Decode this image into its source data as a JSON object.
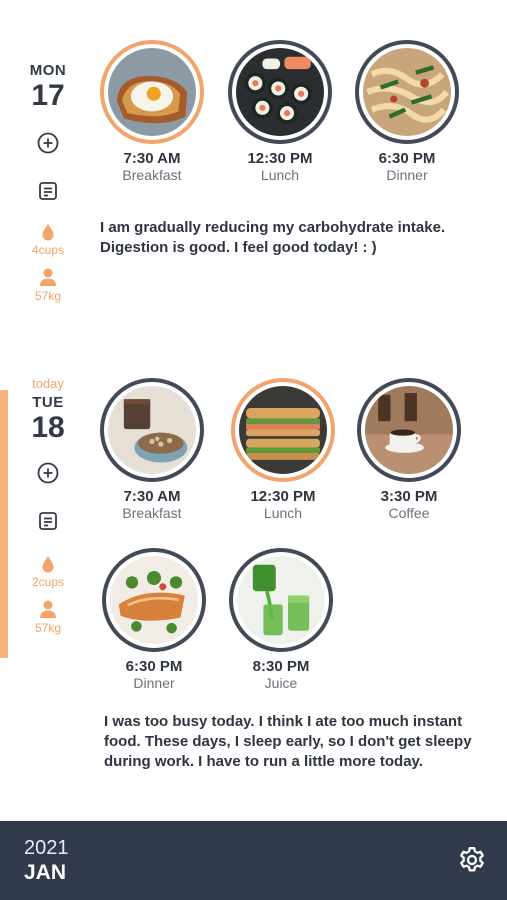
{
  "days": [
    {
      "today_label": "",
      "dow": "MON",
      "date": "17",
      "water": "4cups",
      "weight": "57kg",
      "meals": [
        {
          "time": "7:30 AM",
          "label": "Breakfast",
          "highlight": true,
          "photo": "toast-egg"
        },
        {
          "time": "12:30 PM",
          "label": "Lunch",
          "highlight": false,
          "photo": "sushi"
        },
        {
          "time": "6:30 PM",
          "label": "Dinner",
          "highlight": false,
          "photo": "pasta"
        }
      ],
      "note": "I am gradually reducing my carbohydrate intake. Digestion is good. I feel good today! : )"
    },
    {
      "today_label": "today",
      "dow": "TUE",
      "date": "18",
      "water": "2cups",
      "weight": "57kg",
      "meals": [
        {
          "time": "7:30 AM",
          "label": "Breakfast",
          "highlight": false,
          "photo": "granola-coffee"
        },
        {
          "time": "12:30 PM",
          "label": "Lunch",
          "highlight": true,
          "photo": "sandwich"
        },
        {
          "time": "3:30 PM",
          "label": "Coffee",
          "highlight": false,
          "photo": "coffee"
        },
        {
          "time": "6:30 PM",
          "label": "Dinner",
          "highlight": false,
          "photo": "salmon"
        },
        {
          "time": "8:30 PM",
          "label": "Juice",
          "highlight": false,
          "photo": "juice"
        }
      ],
      "note": "I was too busy today. I think I ate too much instant food. These days, I sleep early, so I don't get sleepy during work. I have to run a little more today."
    }
  ],
  "footer": {
    "year": "2021",
    "month": "JAN"
  },
  "colors": {
    "accent": "#f2a46c",
    "ring": "#424a57",
    "bar": "#313a4b"
  },
  "icons": {
    "add": "plus-circle-icon",
    "note": "note-icon",
    "water": "water-drop-icon",
    "weight": "person-icon",
    "settings": "gear-icon"
  }
}
